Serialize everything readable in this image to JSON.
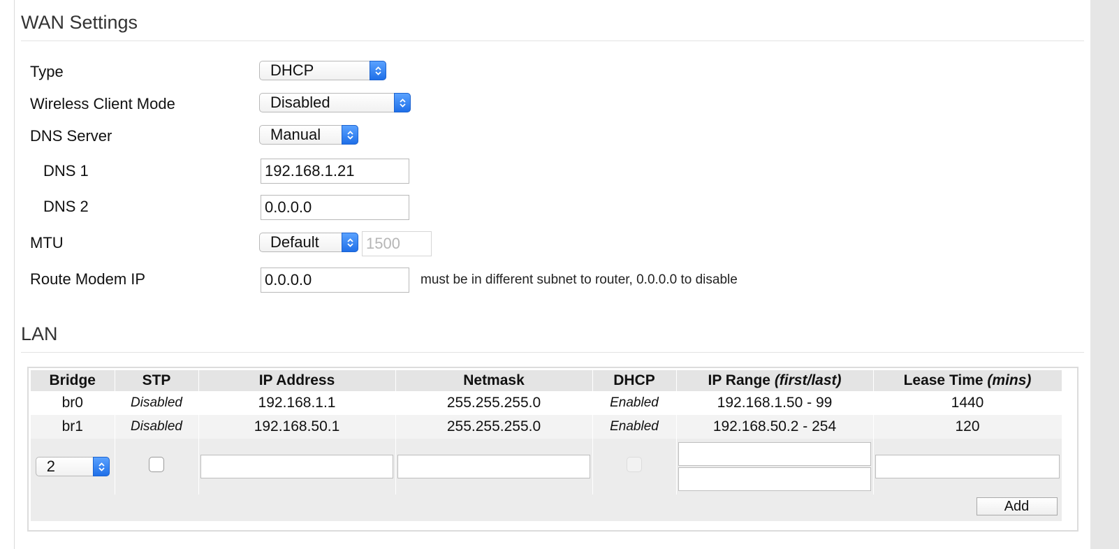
{
  "wan": {
    "title": "WAN Settings",
    "type": {
      "label": "Type",
      "value": "DHCP"
    },
    "wireless_client_mode": {
      "label": "Wireless Client Mode",
      "value": "Disabled"
    },
    "dns_server": {
      "label": "DNS Server",
      "value": "Manual"
    },
    "dns1": {
      "label": "DNS 1",
      "value": "192.168.1.21"
    },
    "dns2": {
      "label": "DNS 2",
      "value": "0.0.0.0"
    },
    "mtu": {
      "label": "MTU",
      "mode": "Default",
      "value": "1500"
    },
    "route_modem_ip": {
      "label": "Route Modem IP",
      "value": "0.0.0.0",
      "hint": "must be in different subnet to router, 0.0.0.0 to disable"
    }
  },
  "lan": {
    "title": "LAN",
    "headers": {
      "bridge": "Bridge",
      "stp": "STP",
      "ip": "IP Address",
      "netmask": "Netmask",
      "dhcp": "DHCP",
      "range": "IP Range",
      "range_note": "(first/last)",
      "lease": "Lease Time",
      "lease_note": "(mins)"
    },
    "rows": [
      {
        "bridge": "br0",
        "stp": "Disabled",
        "ip": "192.168.1.1",
        "netmask": "255.255.255.0",
        "dhcp": "Enabled",
        "range": "192.168.1.50 - 99",
        "lease": "1440"
      },
      {
        "bridge": "br1",
        "stp": "Disabled",
        "ip": "192.168.50.1",
        "netmask": "255.255.255.0",
        "dhcp": "Enabled",
        "range": "192.168.50.2 - 254",
        "lease": "120"
      }
    ],
    "new_bridge_value": "2",
    "add_label": "Add"
  },
  "icons": {
    "select_caret": "updown-chevron-icon"
  }
}
